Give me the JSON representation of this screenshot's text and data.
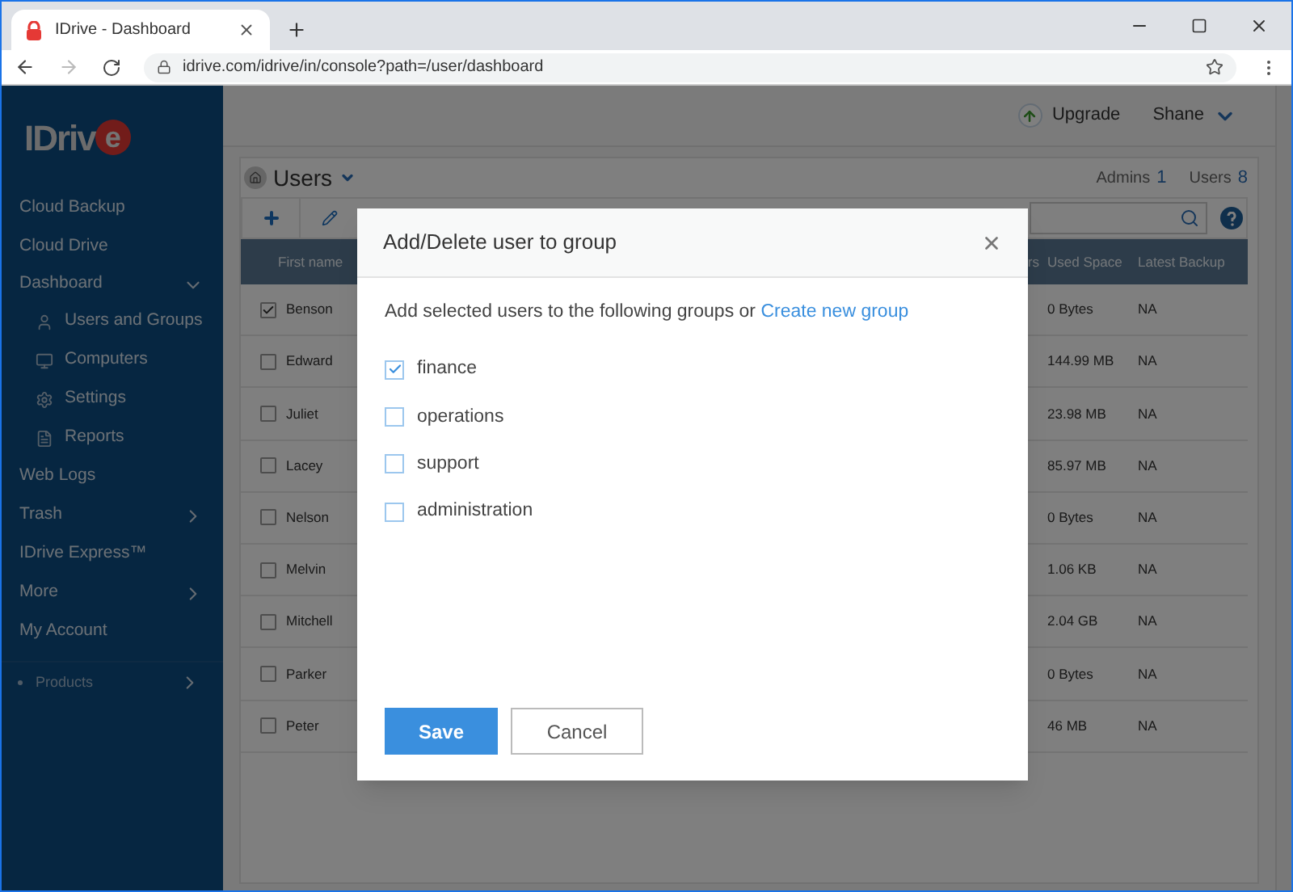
{
  "browser": {
    "tab_title": "IDrive - Dashboard",
    "url": "idrive.com/idrive/in/console?path=/user/dashboard"
  },
  "sidebar": {
    "logo": "IDriv",
    "logo_e": "e",
    "items": [
      {
        "label": "Cloud Backup",
        "kind": "main"
      },
      {
        "label": "Cloud Drive",
        "kind": "main"
      },
      {
        "label": "Dashboard",
        "kind": "expand",
        "expanded": true,
        "children": [
          {
            "label": "Users and Groups",
            "kind": "user"
          },
          {
            "label": "Computers",
            "kind": "computer"
          },
          {
            "label": "Settings",
            "kind": "gear"
          },
          {
            "label": "Reports",
            "kind": "report"
          }
        ]
      },
      {
        "label": "Web Logs",
        "kind": "main"
      },
      {
        "label": "Trash",
        "kind": "more"
      },
      {
        "label": "IDrive Express™",
        "kind": "main"
      },
      {
        "label": "More",
        "kind": "more"
      },
      {
        "label": "My Account",
        "kind": "main"
      },
      {
        "label": "Products",
        "kind": "small"
      }
    ]
  },
  "header": {
    "upgrade": "Upgrade",
    "user": "Shane"
  },
  "page": {
    "title": "Users",
    "admins_label": "Admins",
    "admins_count": "1",
    "users_label": "Users",
    "users_count": "8"
  },
  "table": {
    "columns": [
      "First name",
      "rs",
      "Used Space",
      "Latest Backup"
    ],
    "rows": [
      {
        "first_name": "Benson",
        "used_space": "0 Bytes",
        "latest_backup": "NA",
        "checked": true
      },
      {
        "first_name": "Edward",
        "used_space": "144.99 MB",
        "latest_backup": "NA",
        "checked": false
      },
      {
        "first_name": "Juliet",
        "used_space": "23.98 MB",
        "latest_backup": "NA",
        "checked": false
      },
      {
        "first_name": "Lacey",
        "used_space": "85.97 MB",
        "latest_backup": "NA",
        "checked": false
      },
      {
        "first_name": "Nelson",
        "used_space": "0 Bytes",
        "latest_backup": "NA",
        "checked": false
      },
      {
        "first_name": "Melvin",
        "used_space": "1.06 KB",
        "latest_backup": "NA",
        "checked": false
      },
      {
        "first_name": "Mitchell",
        "used_space": "2.04 GB",
        "latest_backup": "NA",
        "checked": false
      },
      {
        "first_name": "Parker",
        "used_space": "0 Bytes",
        "latest_backup": "NA",
        "checked": false
      },
      {
        "first_name": "Peter",
        "used_space": "46 MB",
        "latest_backup": "NA",
        "checked": false
      }
    ]
  },
  "dialog": {
    "title": "Add/Delete user to group",
    "intro": "Add selected users to the following groups or",
    "link": "Create new group",
    "groups": [
      {
        "label": "finance",
        "checked": true
      },
      {
        "label": "operations",
        "checked": false
      },
      {
        "label": "support",
        "checked": false
      },
      {
        "label": "administration",
        "checked": false
      }
    ],
    "save": "Save",
    "cancel": "Cancel"
  }
}
